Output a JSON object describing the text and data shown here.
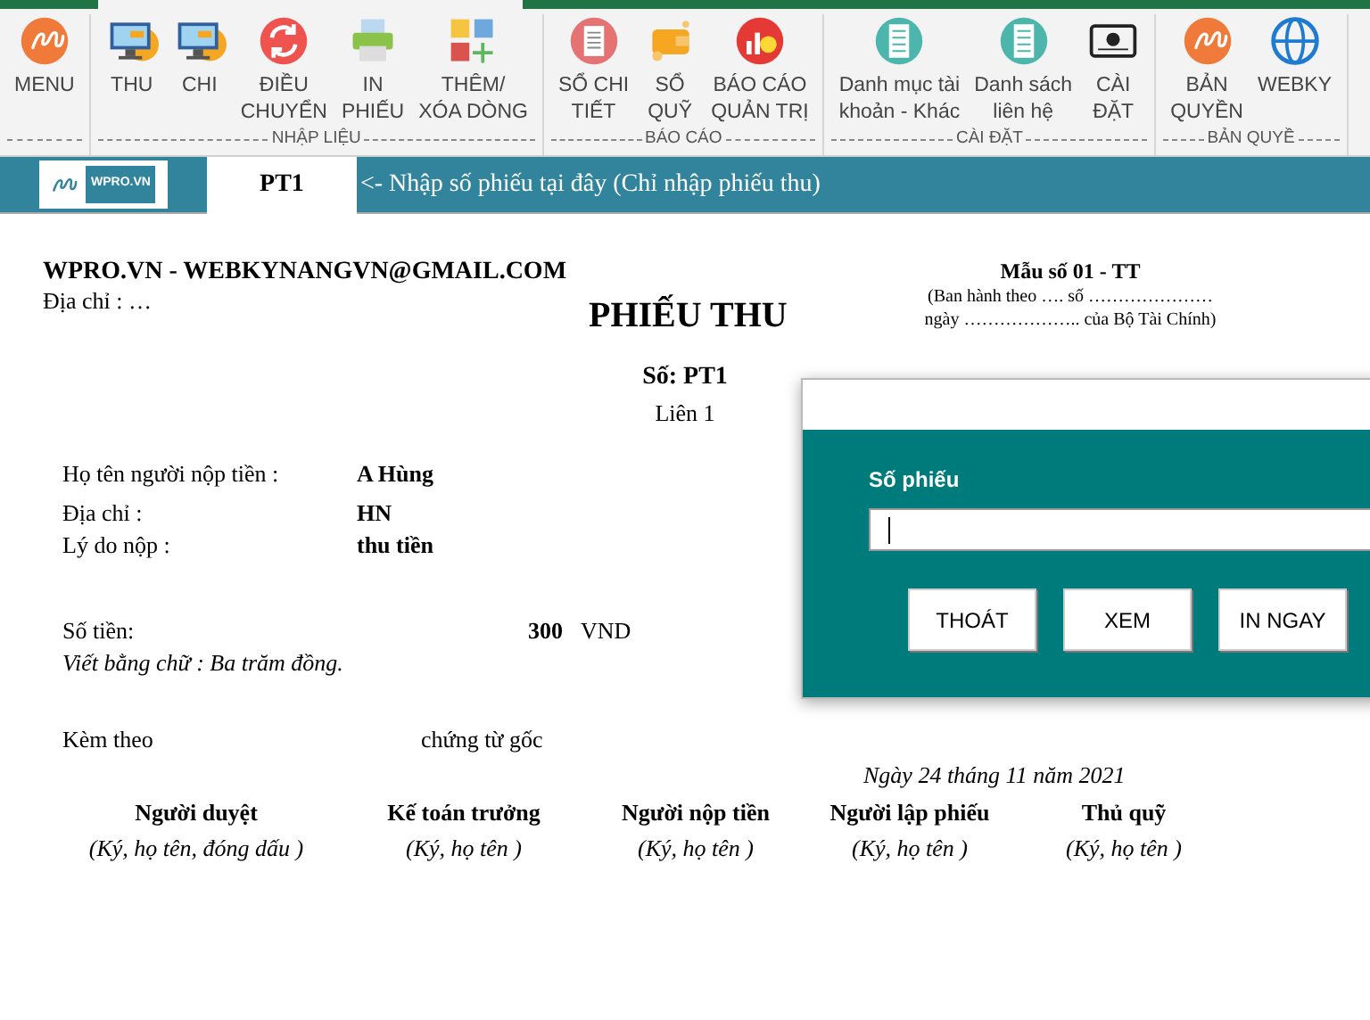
{
  "ribbon": {
    "groups": [
      {
        "buttons": [
          {
            "label": [
              "MENU"
            ]
          }
        ]
      },
      {
        "label": "NHẬP LIỆU",
        "buttons": [
          {
            "label": [
              "THU"
            ]
          },
          {
            "label": [
              "CHI"
            ]
          },
          {
            "label": [
              "ĐIỀU",
              "CHUYỂN"
            ]
          },
          {
            "label": [
              "IN",
              "PHIẾU"
            ]
          },
          {
            "label": [
              "THÊM/",
              "XÓA DÒNG"
            ]
          }
        ]
      },
      {
        "label": "BÁO CÁO",
        "buttons": [
          {
            "label": [
              "SỔ CHI",
              "TIẾT"
            ]
          },
          {
            "label": [
              "SỔ",
              "QUỸ"
            ]
          },
          {
            "label": [
              "BÁO CÁO",
              "QUẢN TRỊ"
            ]
          }
        ]
      },
      {
        "label": "CÀI ĐẶT",
        "buttons": [
          {
            "label": [
              "Danh mục tài",
              "khoản - Khác"
            ]
          },
          {
            "label": [
              "Danh sách",
              "liên hệ"
            ]
          },
          {
            "label": [
              "CÀI",
              "ĐẶT"
            ]
          }
        ]
      },
      {
        "label": "BẢN QUYỀ",
        "buttons": [
          {
            "label": [
              "BẢN",
              "QUYỀN"
            ]
          },
          {
            "label": [
              "WEBKY"
            ]
          }
        ]
      }
    ]
  },
  "toolbar": {
    "logo_text": "WPRO.VN",
    "voucher_cell": "PT1",
    "hint": "<- Nhập số phiếu tại đây (Chỉ nhập phiếu thu)"
  },
  "document": {
    "company": "WPRO.VN - WEBKYNANGVN@GMAIL.COM",
    "address": "Địa chỉ : …",
    "title": "PHIẾU THU",
    "form_code": "Mẫu số 01 - TT",
    "form_note": [
      "(Ban hành theo …. số …………………",
      "ngày ……………….. của Bộ Tài Chính)"
    ],
    "number": "Số: PT1",
    "copy": "Liên 1",
    "fields": [
      {
        "label": "Họ tên người nộp tiền :",
        "value": "A Hùng"
      },
      {
        "label": "Địa chỉ :",
        "value": "HN"
      },
      {
        "label": "Lý do nộp :",
        "value": "thu tiền"
      }
    ],
    "amount_label": "Số tiền:",
    "amount": "300",
    "currency": "VND",
    "amount_words": "Viết bằng chữ : Ba trăm đồng.",
    "attach_label": "Kèm theo",
    "attach_suffix": "chứng từ gốc",
    "date": "Ngày  24 tháng 11 năm 2021",
    "signatures": [
      {
        "role": "Người duyệt",
        "note": "(Ký, họ tên, đóng dấu )"
      },
      {
        "role": "Kế toán trưởng",
        "note": "(Ký, họ tên )"
      },
      {
        "role": "Người nộp tiền",
        "note": "(Ký, họ tên )"
      },
      {
        "role": "Người lập phiếu",
        "note": "(Ký, họ tên )"
      },
      {
        "role": "Thủ quỹ",
        "note": "(Ký, họ tên )"
      }
    ]
  },
  "dialog": {
    "label": "Số phiếu",
    "focused": true,
    "buttons": [
      "THOÁT",
      "XEM",
      "IN NGAY"
    ]
  }
}
